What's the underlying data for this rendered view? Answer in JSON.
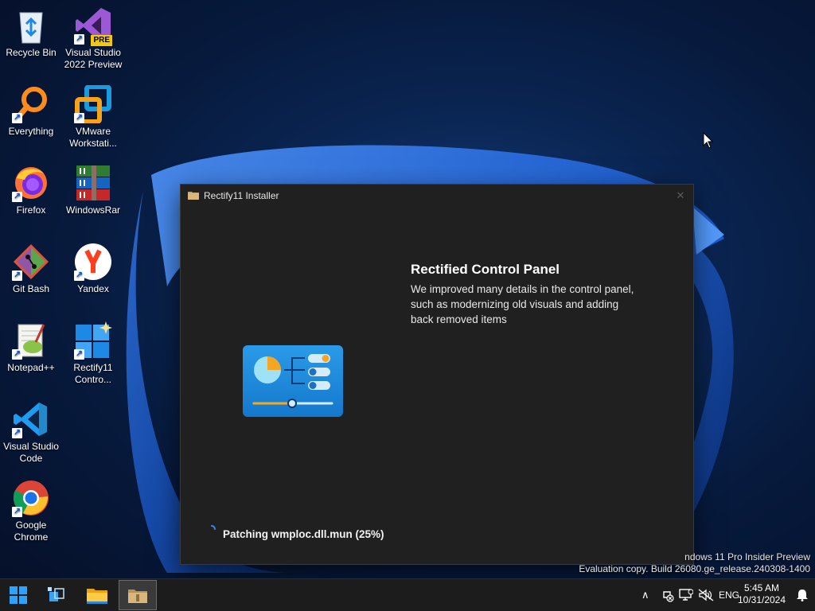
{
  "desktop": {
    "icons": [
      {
        "label": "Recycle Bin",
        "icon": "recycle-bin-icon"
      },
      {
        "label": "Visual Studio 2022 Preview",
        "icon": "visual-studio-preview-icon",
        "badge": "PRE"
      },
      {
        "label": "Everything",
        "icon": "everything-search-icon"
      },
      {
        "label": "VMware Workstati...",
        "icon": "vmware-icon"
      },
      {
        "label": "Firefox",
        "icon": "firefox-icon"
      },
      {
        "label": "WindowsRar",
        "icon": "winrar-icon"
      },
      {
        "label": "Git Bash",
        "icon": "git-bash-icon"
      },
      {
        "label": "Yandex",
        "icon": "yandex-icon"
      },
      {
        "label": "Notepad++",
        "icon": "notepadpp-icon"
      },
      {
        "label": "Rectify11 Contro...",
        "icon": "rectify11-control-icon"
      },
      {
        "label": "Visual Studio Code",
        "icon": "vscode-icon"
      },
      {
        "label": "Google Chrome",
        "icon": "chrome-icon"
      }
    ]
  },
  "installer": {
    "title": "Rectify11 Installer",
    "feature_title": "Rectified Control Panel",
    "feature_description": "We improved many details in the control panel, such as modernizing old visuals and adding back removed items",
    "status": "Patching wmploc.dll.mun (25%)",
    "progress_percent": 25
  },
  "watermark": {
    "line1": "ndows 11 Pro Insider Preview",
    "line2": "Evaluation copy. Build 26080.ge_release.240308-1400"
  },
  "taskbar": {
    "buttons": [
      "start-icon",
      "task-view-icon",
      "file-explorer-icon",
      "installer-app-icon"
    ],
    "tray": {
      "language": "ENG",
      "time": "5:45 AM",
      "date": "10/31/2024"
    }
  },
  "colors": {
    "accent": "#0078d4",
    "window_bg": "#202020",
    "taskbar_bg": "#1c1c1c"
  }
}
